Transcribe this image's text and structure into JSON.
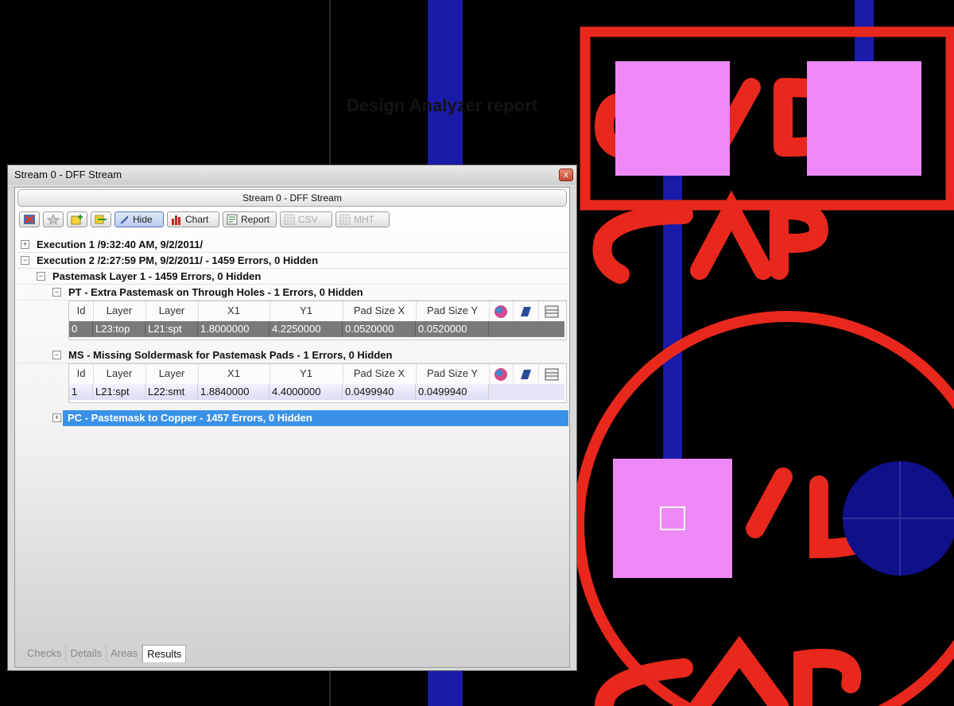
{
  "window": {
    "title": "Stream 0 - DFF Stream",
    "close_glyph": "x",
    "header": "Stream 0 - DFF Stream"
  },
  "toolbar": {
    "hide_label": "Hide",
    "chart_label": "Chart",
    "report_label": "Report",
    "csv_label": "CSV",
    "mht_label": "MHT",
    "icons": [
      "x-icon",
      "star-icon",
      "add-layer-icon",
      "merge-icon"
    ]
  },
  "tree": {
    "execution1": "Execution 1 /9:32:40 AM, 9/2/2011/",
    "execution2": "Execution 2 /2:27:59 PM, 9/2/2011/ - 1459 Errors, 0 Hidden",
    "layer": "Pastemask Layer 1 - 1459 Errors, 0 Hidden",
    "pt_check": "PT - Extra Pastemask on Through Holes - 1 Errors, 0 Hidden",
    "ms_check": "MS - Missing Soldermask for Pastemask Pads - 1 Errors, 0 Hidden",
    "pc_check": "PC - Pastemask to Copper - 1457 Errors, 0 Hidden",
    "expand_glyph": "+",
    "collapse_glyph": "−"
  },
  "grid_columns": [
    "Id",
    "Layer",
    "Layer",
    "X1",
    "Y1",
    "Pad Size X",
    "Pad Size Y"
  ],
  "pt_rows": [
    [
      "0",
      "L23:top",
      "L21:spt",
      "1.8000000",
      "4.2250000",
      "0.0520000",
      "0.0520000"
    ]
  ],
  "ms_rows": [
    [
      "1",
      "L21:spt",
      "L22:smt",
      "1.8840000",
      "4.4000000",
      "0.0499940",
      "0.0499940"
    ]
  ],
  "tabs": [
    "Checks",
    "Details",
    "Areas",
    "Results"
  ],
  "active_tab": "Results",
  "background": {
    "report_title": "Design Analyzer report",
    "pcb_labels": [
      "S/D",
      "CAP",
      "/D",
      "CAP"
    ]
  },
  "colors": {
    "pcb_red": "#e8281c",
    "pcb_blue": "#1a1aa8",
    "pad_pink": "#ee88f6",
    "selection_blue": "#3a92e8"
  }
}
